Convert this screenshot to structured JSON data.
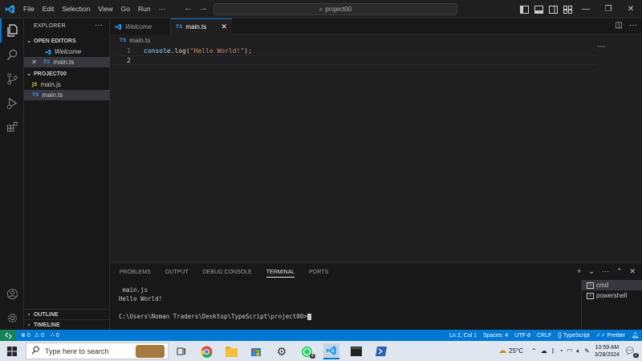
{
  "titlebar": {
    "menu": [
      "File",
      "Edit",
      "Selection",
      "View",
      "Go",
      "Run",
      "···"
    ],
    "search_text": "project00",
    "icons": [
      "vscode-logo-icon",
      "back-arrow-icon",
      "forward-arrow-icon",
      "search-icon",
      "toggle-sidebar-icon",
      "toggle-panel-icon",
      "toggle-secondary-sidebar-icon",
      "customize-layout-icon"
    ],
    "window_buttons": [
      "—",
      "❐",
      "✕"
    ]
  },
  "sidebar": {
    "title": "EXPLORER",
    "more": "···",
    "open_editors_label": "OPEN EDITORS",
    "open_editors": [
      {
        "badge": "",
        "label": "Welcome"
      },
      {
        "badge": "TS",
        "label": "main.ts"
      }
    ],
    "project_label": "PROJECT00",
    "files": [
      {
        "badge": "JS",
        "label": "main.js"
      },
      {
        "badge": "TS",
        "label": "main.ts"
      }
    ],
    "outline_label": "OUTLINE",
    "timeline_label": "TIMELINE"
  },
  "tabs": [
    {
      "label": "Welcome",
      "active": false
    },
    {
      "label": "main.ts",
      "active": true,
      "badge": "TS",
      "close": "✕"
    }
  ],
  "breadcrumb": {
    "badge": "TS",
    "file": "main.ts"
  },
  "editor": {
    "lines": [
      {
        "num": "1",
        "code": {
          "obj": "console",
          "dot": ".",
          "fn": "log",
          "open": "(",
          "str": "\"Hello World!\"",
          "close": ");"
        }
      },
      {
        "num": "2",
        "code": {}
      }
    ]
  },
  "panel": {
    "tabs": [
      "PROBLEMS",
      "OUTPUT",
      "DEBUG CONSOLE",
      "TERMINAL",
      "PORTS"
    ],
    "active_tab": "TERMINAL",
    "terminal_lines": [
      " main.js",
      "Hello World!",
      "",
      "C:\\Users\\Noman Traders\\Desktop\\TypeScript\\project00>"
    ],
    "terminals": [
      "cmd",
      "powershell"
    ],
    "actions": [
      "+",
      "⌄",
      "···",
      "⌃",
      "✕"
    ]
  },
  "statusbar": {
    "errors": "0",
    "warnings": "0",
    "ports": "0",
    "position": "Ln 2, Col 1",
    "spaces": "Spaces: 4",
    "encoding": "UTF-8",
    "eol": "CRLF",
    "language": "TypeScript",
    "formatter": "Prettier"
  },
  "taskbar": {
    "search_placeholder": "Type here to search",
    "temperature": "25°C",
    "time": "10:59 AM",
    "date": "3/28/2024",
    "notification_count": "2",
    "whatsapp_badge": "4"
  },
  "colors": {
    "accent": "#0078d4",
    "ts_badge": "#3b8ee8",
    "js_badge": "#d4c24b",
    "string": "#ce9178",
    "function": "#dcdcaa"
  }
}
